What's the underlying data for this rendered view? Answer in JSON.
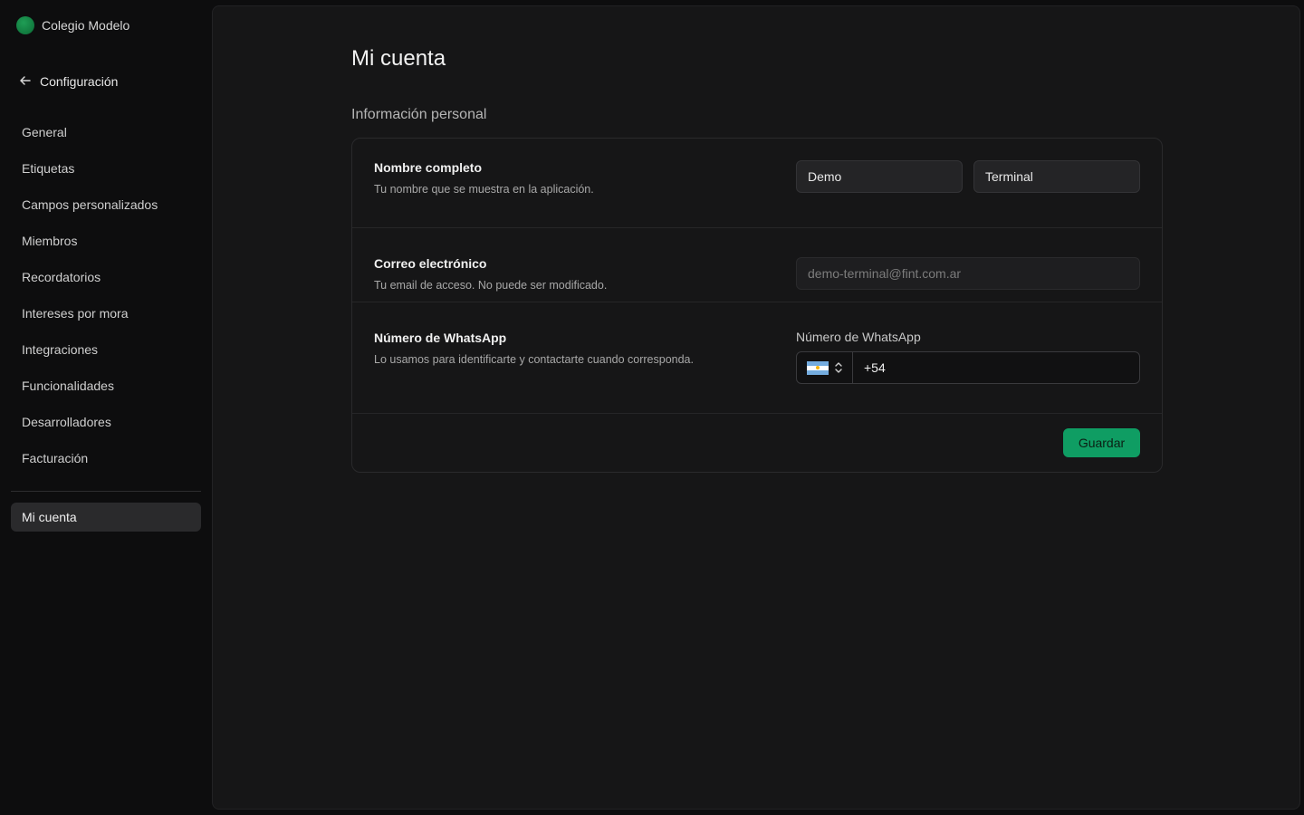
{
  "org": {
    "name": "Colegio Modelo",
    "logo_color": "#16a34a"
  },
  "sidebar": {
    "back_label": "Configuración",
    "items": [
      {
        "label": "General"
      },
      {
        "label": "Etiquetas"
      },
      {
        "label": "Campos personalizados"
      },
      {
        "label": "Miembros"
      },
      {
        "label": "Recordatorios"
      },
      {
        "label": "Intereses por mora"
      },
      {
        "label": "Integraciones"
      },
      {
        "label": "Funcionalidades"
      },
      {
        "label": "Desarrolladores"
      },
      {
        "label": "Facturación"
      }
    ],
    "active_item": "Mi cuenta"
  },
  "main": {
    "title": "Mi cuenta",
    "section_title": "Información personal",
    "name_row": {
      "label": "Nombre completo",
      "description": "Tu nombre que se muestra en la aplicación.",
      "first_name": "Demo",
      "last_name": "Terminal"
    },
    "email_row": {
      "label": "Correo electrónico",
      "description": "Tu email de acceso. No puede ser modificado.",
      "value": "demo-terminal@fint.com.ar"
    },
    "whatsapp_row": {
      "label": "Número de WhatsApp",
      "description": "Lo usamos para identificarte y contactarte cuando corresponda.",
      "field_label": "Número de WhatsApp",
      "country_icon": "argentina-flag-icon",
      "value": "+54"
    },
    "save_label": "Guardar",
    "accent_color": "#0f9d63"
  }
}
